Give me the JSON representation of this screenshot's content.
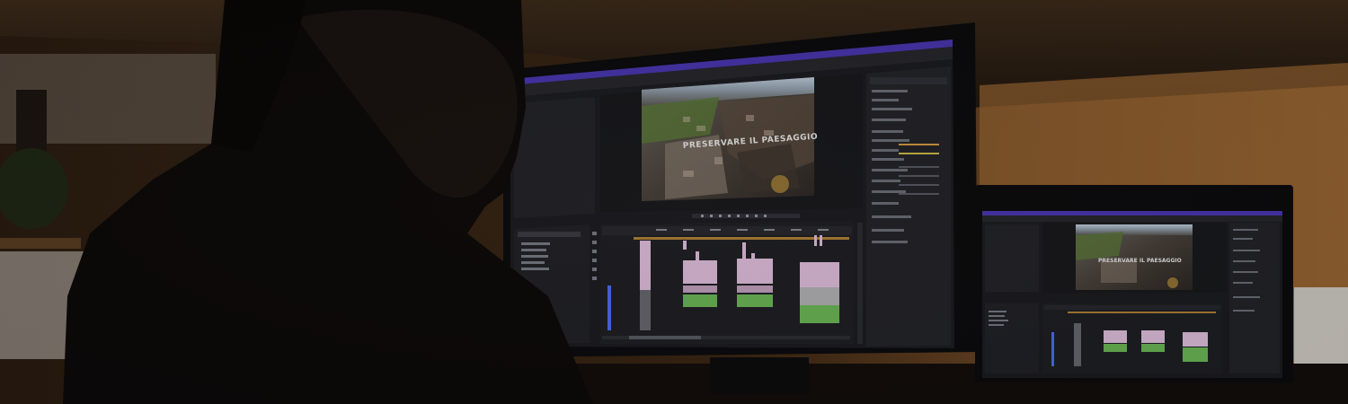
{
  "scene": {
    "description_hidden": false,
    "colors": {
      "wall_warm": "#8a5a2c",
      "ceiling": "#4a3320",
      "ui_bg": "#1b1c21",
      "ui_panel": "#222329",
      "ui_accent": "#6c4cff",
      "clip_pink": "#e9c6e6",
      "clip_green": "#6fbf5a",
      "playhead_blue": "#4d72ff"
    }
  },
  "main_monitor": {
    "preview_overlay_text": "PRESERVARE IL PAESAGGIO"
  },
  "secondary_monitor": {
    "preview_overlay_text": "PRESERVARE IL PAESAGGIO"
  }
}
